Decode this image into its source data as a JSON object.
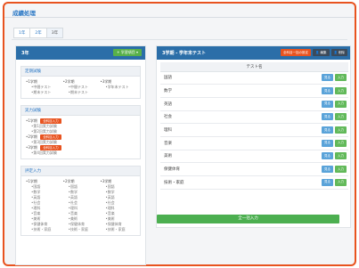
{
  "app": {
    "title": "成績処理"
  },
  "tabs": [
    "1年",
    "2年",
    "3年"
  ],
  "left": {
    "class_label": "3年",
    "add_button": "+ 学習項目 ▾",
    "sections": {
      "regular": {
        "title": "定期試験",
        "cols": [
          {
            "head": "•1学期",
            "items": [
              "•中間テスト",
              "•期末テスト"
            ]
          },
          {
            "head": "•2学期",
            "items": [
              "•中間テスト",
              "•期末テスト"
            ]
          },
          {
            "head": "•3学期",
            "items": [
              "•学年末テスト"
            ]
          }
        ]
      },
      "proficiency": {
        "title": "実力試験",
        "groups": [
          {
            "head": "•1学期",
            "badge": "全科目入力",
            "items": [
              "•第1回実力試験",
              "•第2回実力試験"
            ]
          },
          {
            "head": "•2学期",
            "badge": "全科目入力",
            "items": [
              "•第3回実力試験"
            ]
          },
          {
            "head": "•3学期",
            "badge": "全科目入力",
            "items": [
              "•第4回実力試験"
            ]
          }
        ]
      },
      "grades": {
        "title": "評定入力",
        "cols": [
          {
            "head": "•1学期",
            "items": [
              "•国語",
              "•数学",
              "•英語",
              "•社会",
              "•理科",
              "•音楽",
              "•美術",
              "•保健体育",
              "•技術・家庭"
            ]
          },
          {
            "head": "•2学期",
            "items": [
              "•国語",
              "•数学",
              "•英語",
              "•社会",
              "•理科",
              "•音楽",
              "•美術",
              "•保健体育",
              "•技術・家庭"
            ]
          },
          {
            "head": "•3学期",
            "items": [
              "•国語",
              "•数学",
              "•英語",
              "•社会",
              "•理科",
              "•音楽",
              "•美術",
              "•保健体育",
              "•技術・家庭"
            ]
          }
        ]
      }
    }
  },
  "right": {
    "title": "3学期 - 学年末テスト",
    "buttons": {
      "bulk_entry": "全科目一括の設定",
      "edit": "編集",
      "delete": "削除"
    },
    "table": {
      "header": "テスト名",
      "rows": [
        "国語",
        "数学",
        "英語",
        "社会",
        "理科",
        "音楽",
        "美術",
        "保健体育",
        "技術・家庭"
      ],
      "view_label": "見る",
      "input_label": "入力"
    },
    "bulk_button": "全一括入力"
  }
}
